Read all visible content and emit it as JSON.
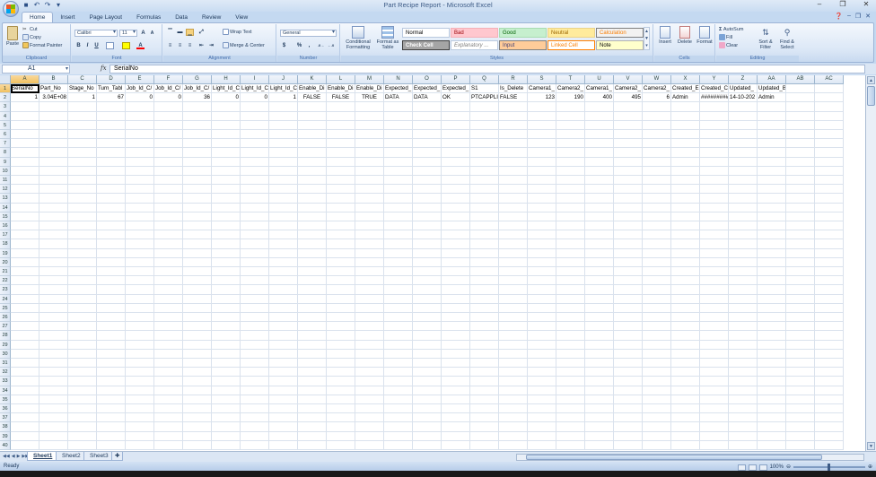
{
  "window": {
    "title": "Part Recipe Report - Microsoft Excel"
  },
  "ribbon_tabs": [
    "Home",
    "Insert",
    "Page Layout",
    "Formulas",
    "Data",
    "Review",
    "View"
  ],
  "clipboard": {
    "paste": "Paste",
    "cut": "Cut",
    "copy": "Copy",
    "format_painter": "Format Painter",
    "label": "Clipboard"
  },
  "font": {
    "name": "Calibri",
    "size": "11",
    "label": "Font",
    "bold": "B",
    "italic": "I",
    "underline": "U"
  },
  "alignment": {
    "wrap_text": "Wrap Text",
    "merge_center": "Merge & Center",
    "label": "Alignment"
  },
  "number": {
    "format": "General",
    "percent": "%",
    "comma": ",",
    "label": "Number"
  },
  "styles": {
    "conditional_formatting": "Conditional Formatting",
    "format_as_table": "Format as Table",
    "label": "Styles",
    "cells": [
      {
        "name": "Normal",
        "bg": "#ffffff",
        "fg": "#000000",
        "border": "#b9c9df"
      },
      {
        "name": "Bad",
        "bg": "#ffc7ce",
        "fg": "#9c0006",
        "border": "#f4b0b8"
      },
      {
        "name": "Good",
        "bg": "#c6efce",
        "fg": "#006100",
        "border": "#a8dcb2"
      },
      {
        "name": "Neutral",
        "bg": "#ffeb9c",
        "fg": "#9c6500",
        "border": "#ead38a"
      },
      {
        "name": "Calculation",
        "bg": "#f2f2f2",
        "fg": "#fa7d00",
        "border": "#7f7f7f"
      },
      {
        "name": "Check Cell",
        "bg": "#a5a5a5",
        "fg": "#ffffff",
        "border": "#3f3f3f"
      },
      {
        "name": "Explanatory ...",
        "bg": "#ffffff",
        "fg": "#7f7f7f",
        "border": "#b9c9df"
      },
      {
        "name": "Input",
        "bg": "#ffcc99",
        "fg": "#3f3f76",
        "border": "#7f7f7f"
      },
      {
        "name": "Linked Cell",
        "bg": "#ffffff",
        "fg": "#fa7d00",
        "border": "#ff8001"
      },
      {
        "name": "Note",
        "bg": "#ffffcc",
        "fg": "#000000",
        "border": "#b2b2b2"
      }
    ]
  },
  "cells_group": {
    "insert": "Insert",
    "delete": "Delete",
    "format": "Format",
    "label": "Cells"
  },
  "editing": {
    "autosum": "AutoSum",
    "fill": "Fill",
    "clear": "Clear",
    "sort_filter": "Sort & Filter",
    "find_select": "Find & Select",
    "label": "Editing"
  },
  "formula_bar": {
    "name_box": "A1",
    "fx": "fx",
    "content": "SerialNo"
  },
  "columns": [
    "A",
    "B",
    "C",
    "D",
    "E",
    "F",
    "G",
    "H",
    "I",
    "J",
    "K",
    "L",
    "M",
    "N",
    "O",
    "P",
    "Q",
    "R",
    "S",
    "T",
    "U",
    "V",
    "W",
    "X",
    "Y",
    "Z",
    "AA",
    "AB",
    "AC"
  ],
  "row1": [
    "SerialNo",
    "Part_No",
    "Stage_No",
    "Turn_Tabl",
    "Job_Id_C/",
    "Job_Id_C/",
    "Job_Id_C/",
    "Light_Id_C",
    "Light_Id_C",
    "Light_Id_C",
    "Enable_Di",
    "Enable_Di",
    "Enable_Di",
    "Expected_",
    "Expected_",
    "Expected_",
    "S1",
    "Is_Delete",
    "Camera1_",
    "Camera2_",
    "Camera1_",
    "Camera2_",
    "Camera2_",
    "Created_E",
    "Created_C",
    "Updated_",
    "Updated_By",
    "",
    ""
  ],
  "row2": [
    "1",
    "3.04E+08",
    "1",
    "67",
    "0",
    "0",
    "36",
    "0",
    "0",
    "1",
    "FALSE",
    "FALSE",
    "TRUE",
    "DATA",
    "DATA",
    "OK",
    "PTCAPPLI",
    "FALSE",
    "123",
    "190",
    "400",
    "495",
    "6",
    "Admin",
    "##########",
    "14-10-202",
    "Admin",
    "",
    ""
  ],
  "row_count": 40,
  "sheets": [
    "Sheet1",
    "Sheet2",
    "Sheet3"
  ],
  "status": {
    "ready": "Ready",
    "zoom": "100%"
  }
}
